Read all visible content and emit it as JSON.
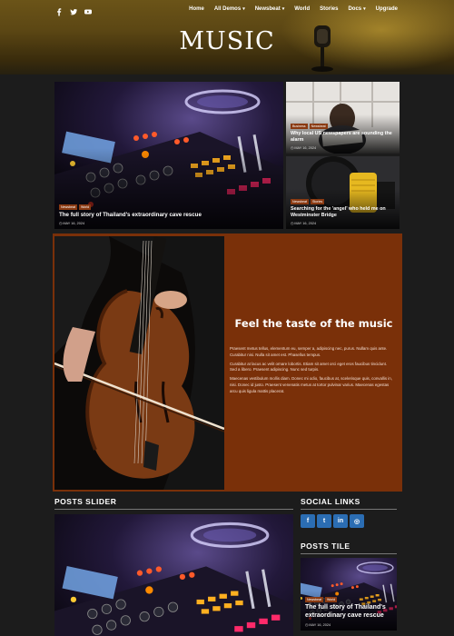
{
  "header": {
    "site_title": "MUSIC",
    "nav": [
      {
        "label": "Home",
        "caret": false
      },
      {
        "label": "All Demos",
        "caret": true
      },
      {
        "label": "Newsbeat",
        "caret": true
      },
      {
        "label": "World",
        "caret": false
      },
      {
        "label": "Stories",
        "caret": false
      },
      {
        "label": "Docs",
        "caret": true
      },
      {
        "label": "Upgrade",
        "caret": false
      }
    ],
    "social_icons": [
      "facebook-icon",
      "twitter-icon",
      "youtube-icon"
    ]
  },
  "featured": {
    "big": {
      "tags": [
        "Newsbeat",
        "World"
      ],
      "title": "The full story of Thailand's extraordinary cave rescue",
      "date": "MAY 16, 2024"
    },
    "small1": {
      "tags": [
        "Business",
        "Newsbeat"
      ],
      "title": "Why local US newspapers are sounding the alarm",
      "date": "MAY 16, 2024"
    },
    "small2": {
      "tags": [
        "Newsbeat",
        "Stories"
      ],
      "title": "Searching for the 'angel' who held me on Westminster Bridge",
      "date": "MAY 16, 2024"
    }
  },
  "promo": {
    "title": "Feel the taste of the music",
    "paragraphs": [
      "Praesent metus tellus, elementum eu, semper a, adipiscing nec, purus. Nullam quis ante. Curabitur nisi. Nulla sit amet est. Phasellus tempus.",
      "Curabitur at lacus ac velit ornare lobortis. Etiam sit amet orci eget eros faucibus tincidunt. Sed a libero. Praesent adipiscing. Nunc sed turpis.",
      "Maecenas vestibulum mollis diam. Donec mi odio, faucibus at, scelerisque quis, convallis in, nisi. Donec id justo. Praesent venenatis metus at tortor pulvinar varius. Maecenas egestas arcu quis ligula mattis placerat."
    ]
  },
  "sections": {
    "posts_slider": "POSTS SLIDER",
    "social_links": "SOCIAL LINKS",
    "posts_tile": "POSTS TILE"
  },
  "social_links": [
    {
      "icon": "facebook-icon",
      "glyph": "f"
    },
    {
      "icon": "twitter-icon",
      "glyph": "t"
    },
    {
      "icon": "linkedin-icon",
      "glyph": "in"
    },
    {
      "icon": "instagram-icon",
      "glyph": "◎"
    }
  ],
  "tile": {
    "tags": [
      "Newsbeat",
      "World"
    ],
    "title": "The full story of Thailand's extraordinary cave rescue",
    "date": "MAY 16, 2024"
  },
  "colors": {
    "accent": "#7a3009",
    "tag": "#8a3a12",
    "social": "#2b6db3",
    "background": "#1c1c1c"
  }
}
